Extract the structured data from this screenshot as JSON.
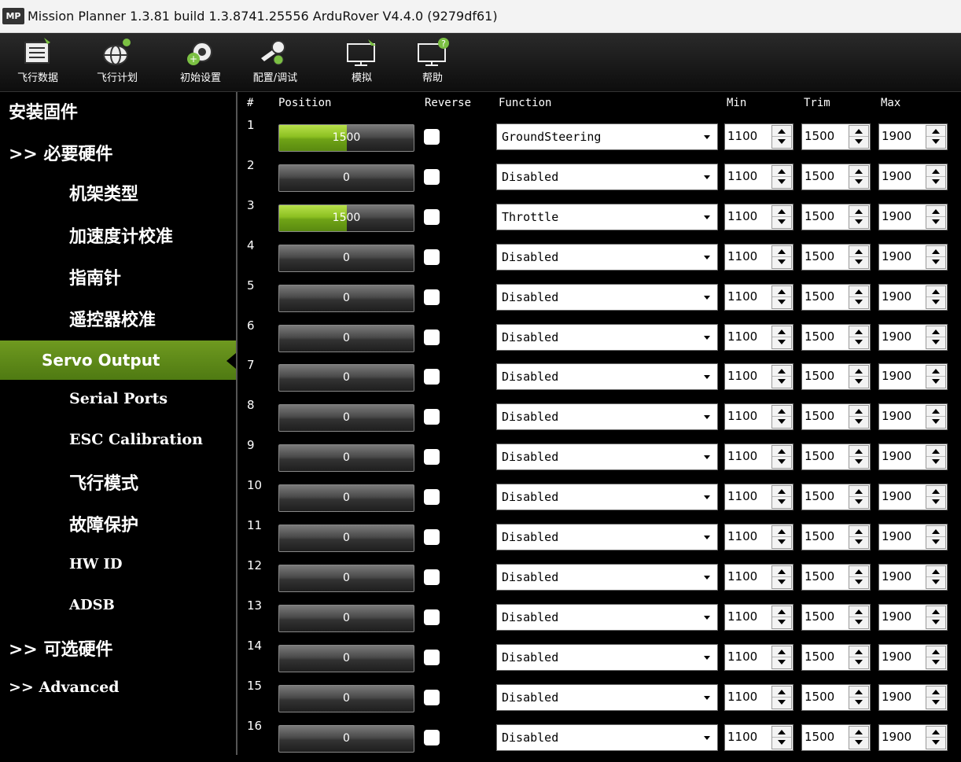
{
  "window": {
    "title": "Mission Planner 1.3.81 build 1.3.8741.25556 ArduRover V4.4.0 (9279df61)",
    "logo_text": "MP"
  },
  "toolbar": {
    "items": [
      {
        "label": "飞行数据",
        "icon": "flight-data-icon"
      },
      {
        "label": "飞行计划",
        "icon": "flight-plan-icon"
      },
      {
        "label": "初始设置",
        "icon": "initial-setup-icon"
      },
      {
        "label": "配置/调试",
        "icon": "config-tuning-icon"
      },
      {
        "label": "模拟",
        "icon": "simulation-icon"
      },
      {
        "label": "帮助",
        "icon": "help-icon"
      }
    ]
  },
  "sidebar": {
    "items": [
      {
        "label": "安装固件"
      },
      {
        "label": ">> 必要硬件"
      },
      {
        "label": "机架类型"
      },
      {
        "label": "加速度计校准"
      },
      {
        "label": "指南针"
      },
      {
        "label": "遥控器校准"
      },
      {
        "label": "Servo Output"
      },
      {
        "label": "Serial Ports"
      },
      {
        "label": "ESC Calibration"
      },
      {
        "label": "飞行模式"
      },
      {
        "label": "故障保护"
      },
      {
        "label": "HW ID"
      },
      {
        "label": "ADSB"
      },
      {
        "label": ">> 可选硬件"
      },
      {
        "label": ">> Advanced"
      }
    ],
    "active": "Servo Output"
  },
  "table": {
    "headers": {
      "num": "#",
      "position": "Position",
      "reverse": "Reverse",
      "function": "Function",
      "min": "Min",
      "trim": "Trim",
      "max": "Max"
    },
    "rows": [
      {
        "num": "1",
        "position": "1500",
        "fill": 0.5,
        "reverse": false,
        "function": "GroundSteering",
        "min": "1100",
        "trim": "1500",
        "max": "1900"
      },
      {
        "num": "2",
        "position": "0",
        "fill": 0,
        "reverse": false,
        "function": "Disabled",
        "min": "1100",
        "trim": "1500",
        "max": "1900"
      },
      {
        "num": "3",
        "position": "1500",
        "fill": 0.5,
        "reverse": false,
        "function": "Throttle",
        "min": "1100",
        "trim": "1500",
        "max": "1900"
      },
      {
        "num": "4",
        "position": "0",
        "fill": 0,
        "reverse": false,
        "function": "Disabled",
        "min": "1100",
        "trim": "1500",
        "max": "1900"
      },
      {
        "num": "5",
        "position": "0",
        "fill": 0,
        "reverse": false,
        "function": "Disabled",
        "min": "1100",
        "trim": "1500",
        "max": "1900"
      },
      {
        "num": "6",
        "position": "0",
        "fill": 0,
        "reverse": false,
        "function": "Disabled",
        "min": "1100",
        "trim": "1500",
        "max": "1900"
      },
      {
        "num": "7",
        "position": "0",
        "fill": 0,
        "reverse": false,
        "function": "Disabled",
        "min": "1100",
        "trim": "1500",
        "max": "1900"
      },
      {
        "num": "8",
        "position": "0",
        "fill": 0,
        "reverse": false,
        "function": "Disabled",
        "min": "1100",
        "trim": "1500",
        "max": "1900"
      },
      {
        "num": "9",
        "position": "0",
        "fill": 0,
        "reverse": false,
        "function": "Disabled",
        "min": "1100",
        "trim": "1500",
        "max": "1900"
      },
      {
        "num": "10",
        "position": "0",
        "fill": 0,
        "reverse": false,
        "function": "Disabled",
        "min": "1100",
        "trim": "1500",
        "max": "1900"
      },
      {
        "num": "11",
        "position": "0",
        "fill": 0,
        "reverse": false,
        "function": "Disabled",
        "min": "1100",
        "trim": "1500",
        "max": "1900"
      },
      {
        "num": "12",
        "position": "0",
        "fill": 0,
        "reverse": false,
        "function": "Disabled",
        "min": "1100",
        "trim": "1500",
        "max": "1900"
      },
      {
        "num": "13",
        "position": "0",
        "fill": 0,
        "reverse": false,
        "function": "Disabled",
        "min": "1100",
        "trim": "1500",
        "max": "1900"
      },
      {
        "num": "14",
        "position": "0",
        "fill": 0,
        "reverse": false,
        "function": "Disabled",
        "min": "1100",
        "trim": "1500",
        "max": "1900"
      },
      {
        "num": "15",
        "position": "0",
        "fill": 0,
        "reverse": false,
        "function": "Disabled",
        "min": "1100",
        "trim": "1500",
        "max": "1900"
      },
      {
        "num": "16",
        "position": "0",
        "fill": 0,
        "reverse": false,
        "function": "Disabled",
        "min": "1100",
        "trim": "1500",
        "max": "1900"
      }
    ]
  },
  "colors": {
    "active_green": "#6f9a20",
    "bar_green": "#8cc021",
    "background": "#000000"
  }
}
